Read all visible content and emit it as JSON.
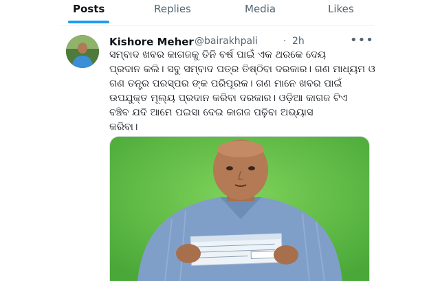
{
  "tabs": [
    {
      "label": "Posts",
      "active": true
    },
    {
      "label": "Replies",
      "active": false
    },
    {
      "label": "Media",
      "active": false
    },
    {
      "label": "Likes",
      "active": false
    }
  ],
  "post": {
    "author_name": "Kishore Meher",
    "handle": "@bairakhpali",
    "separator": "·",
    "time": "2h",
    "more_icon": "more-horizontal-icon",
    "text_lines": [
      "ସମ୍ବାଦ ଖବର କାଗଜକୁ ତିନି ବର୍ଷ ପାଇଁ ଏକ ଥରକେ ଦେୟ",
      "ପ୍ରଦାନ କଲି। ସବୁ ସମ୍ବାଦ ପତ୍ର ତିଷ୍ଠିବା ଦରକାର। ଗଣ ମାଧ୍ୟମ ଓ",
      "ଗଣ ତନ୍ତ୍ର ପରସ୍ପର ଙ୍କ ପରିପୂରକ। ଗଣ ମାନେ ଖବର ପାଇଁ",
      "ଉପଯୁକ୍ତ ମୂଲ୍ୟ ପ୍ରଦାନ କରିବା ଦରକାର। ଓଡ଼ିଆ କାଗଜ ଟିଏ",
      "ବଞ୍ଚିବ ଯଦି ଆମେ ପଇସା ଦେଇ କାଗଜ ପଢ଼ିବା ଅଭ୍ୟାସ",
      "କରିବା।"
    ]
  },
  "colors": {
    "accent": "#1d9bf0",
    "text_primary": "#0f1419",
    "text_secondary": "#536471",
    "photo_background": "#6cc24a"
  }
}
